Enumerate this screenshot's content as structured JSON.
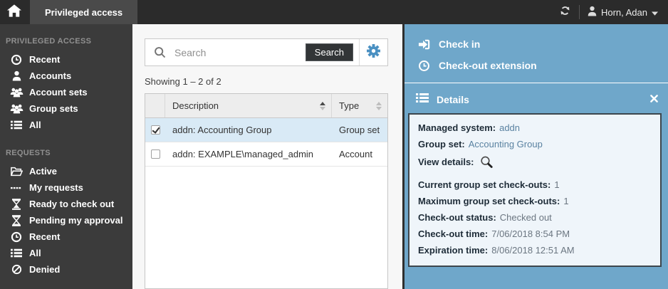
{
  "topbar": {
    "app_tab_label": "Privileged access",
    "user_name": "Horn, Adan",
    "icons": {
      "home": "home-icon",
      "refresh": "refresh-icon",
      "user": "user-icon",
      "caret": "caret-down-icon"
    }
  },
  "sidebar": {
    "sections": [
      {
        "header": "PRIVILEGED ACCESS",
        "items": [
          {
            "label": "Recent",
            "icon": "clock-icon"
          },
          {
            "label": "Accounts",
            "icon": "user-icon"
          },
          {
            "label": "Account sets",
            "icon": "users-icon"
          },
          {
            "label": "Group sets",
            "icon": "users-icon"
          },
          {
            "label": "All",
            "icon": "list-icon"
          }
        ]
      },
      {
        "header": "REQUESTS",
        "items": [
          {
            "label": "Active",
            "icon": "folder-open-icon"
          },
          {
            "label": "My requests",
            "icon": "ellipsis-icon"
          },
          {
            "label": "Ready to check out",
            "icon": "hourglass-filled-icon"
          },
          {
            "label": "Pending my approval",
            "icon": "hourglass-outline-icon"
          },
          {
            "label": "Recent",
            "icon": "clock-icon"
          },
          {
            "label": "All",
            "icon": "list-icon"
          },
          {
            "label": "Denied",
            "icon": "ban-icon"
          }
        ]
      }
    ]
  },
  "search": {
    "placeholder": "Search",
    "value": "",
    "button_label": "Search",
    "icons": {
      "magnifier": "search-icon",
      "settings": "gear-icon"
    }
  },
  "results": {
    "showing_text": "Showing 1 – 2 of 2",
    "columns": {
      "description": "Description",
      "type": "Type"
    },
    "rows": [
      {
        "description": "addn: Accounting Group",
        "type": "Group set",
        "checked": true,
        "selected": true
      },
      {
        "description": "addn: EXAMPLE\\managed_admin",
        "type": "Account",
        "checked": false,
        "selected": false
      }
    ]
  },
  "actions": {
    "check_in": {
      "label": "Check in",
      "icon": "sign-in-icon"
    },
    "checkout_extension": {
      "label": "Check-out extension",
      "icon": "clock-icon"
    }
  },
  "details": {
    "title": "Details",
    "title_icon": "list-icon",
    "close_icon": "close-icon",
    "fields": [
      {
        "label": "Managed system:",
        "value": "addn"
      },
      {
        "label": "Group set:",
        "value": "Accounting Group"
      },
      {
        "label": "View details:",
        "value": "",
        "icon": "magnifier-icon"
      },
      {
        "label": "Current group set check-outs:",
        "value": "1"
      },
      {
        "label": "Maximum group set check-outs:",
        "value": "1"
      },
      {
        "label": "Check-out status:",
        "value": "Checked out"
      },
      {
        "label": "Check-out time:",
        "value": "7/06/2018 8:54 PM"
      },
      {
        "label": "Expiration time:",
        "value": "8/06/2018 12:51 AM"
      }
    ]
  },
  "colors": {
    "topbar_bg": "#2b2b2b",
    "sidebar_bg": "#3b3b3b",
    "tab_bg": "#4a4a4a",
    "panel_blue": "#6fa7ca",
    "selected_row_bg": "#d9eaf6",
    "accent_blue": "#4a90c2",
    "details_box_bg": "#eff5fa",
    "details_box_border": "#3d464d"
  }
}
